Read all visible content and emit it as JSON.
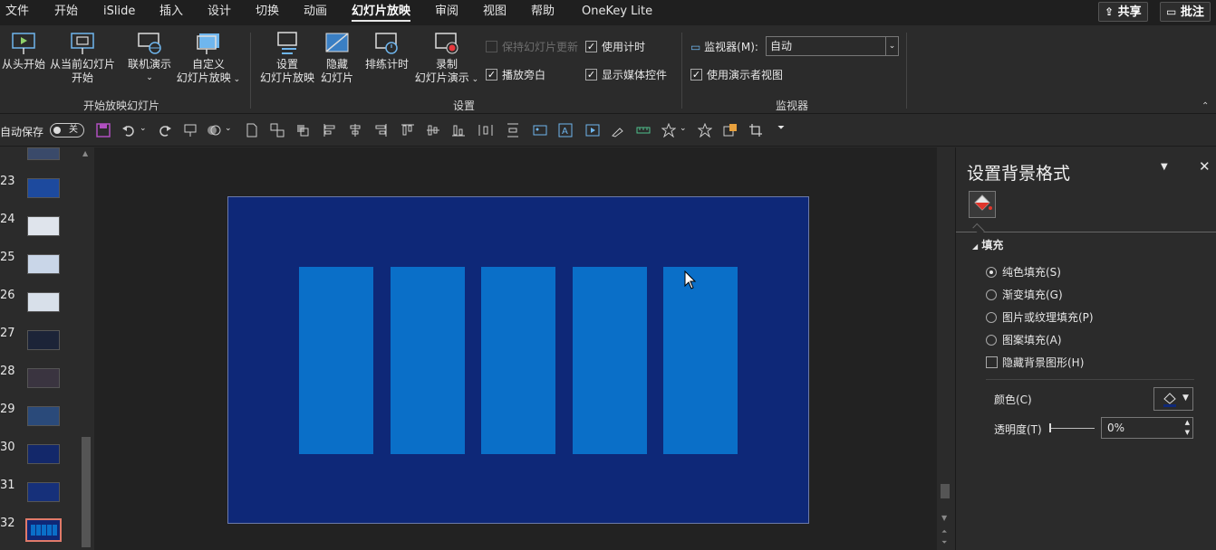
{
  "menu": {
    "tabs": [
      "文件",
      "开始",
      "iSlide",
      "插入",
      "设计",
      "切换",
      "动画",
      "幻灯片放映",
      "审阅",
      "视图",
      "帮助",
      "OneKey Lite"
    ],
    "active_tab": "幻灯片放映",
    "share_label": "共享",
    "comment_label": "批注"
  },
  "ribbon": {
    "start_group": {
      "label": "开始放映幻灯片",
      "from_start": "从头开始",
      "from_current_1": "从当前幻灯片",
      "from_current_2": "开始",
      "online": "联机演示",
      "custom_1": "自定义",
      "custom_2": "幻灯片放映"
    },
    "setup_group": {
      "label": "设置",
      "setup_1": "设置",
      "setup_2": "幻灯片放映",
      "hide_1": "隐藏",
      "hide_2": "幻灯片",
      "rehearse": "排练计时",
      "record_1": "录制",
      "record_2": "幻灯片演示",
      "keep_updated": "保持幻灯片更新",
      "play_narration": "播放旁白",
      "use_timings": "使用计时",
      "show_media": "显示媒体控件"
    },
    "monitor_group": {
      "label": "监视器",
      "monitor_label": "监视器(M):",
      "monitor_value": "自动",
      "presenter_view": "使用演示者视图"
    }
  },
  "qat": {
    "autosave_label": "自动保存",
    "autosave_state": "关"
  },
  "thumbnails": [
    "23",
    "24",
    "25",
    "26",
    "27",
    "28",
    "29",
    "30",
    "31",
    "32"
  ],
  "panel": {
    "title": "设置背景格式",
    "section": "填充",
    "options": [
      "纯色填充(S)",
      "渐变填充(G)",
      "图片或纹理填充(P)",
      "图案填充(A)"
    ],
    "selected_option": 0,
    "hide_bg_graphics": "隐藏背景图形(H)",
    "color_label": "颜色(C)",
    "transparency_label": "透明度(T)",
    "transparency_value": "0%"
  },
  "colors": {
    "slide_bg": "#0e2878",
    "bars": "#0a6fc8",
    "ui_bg": "#2b2b2b"
  }
}
